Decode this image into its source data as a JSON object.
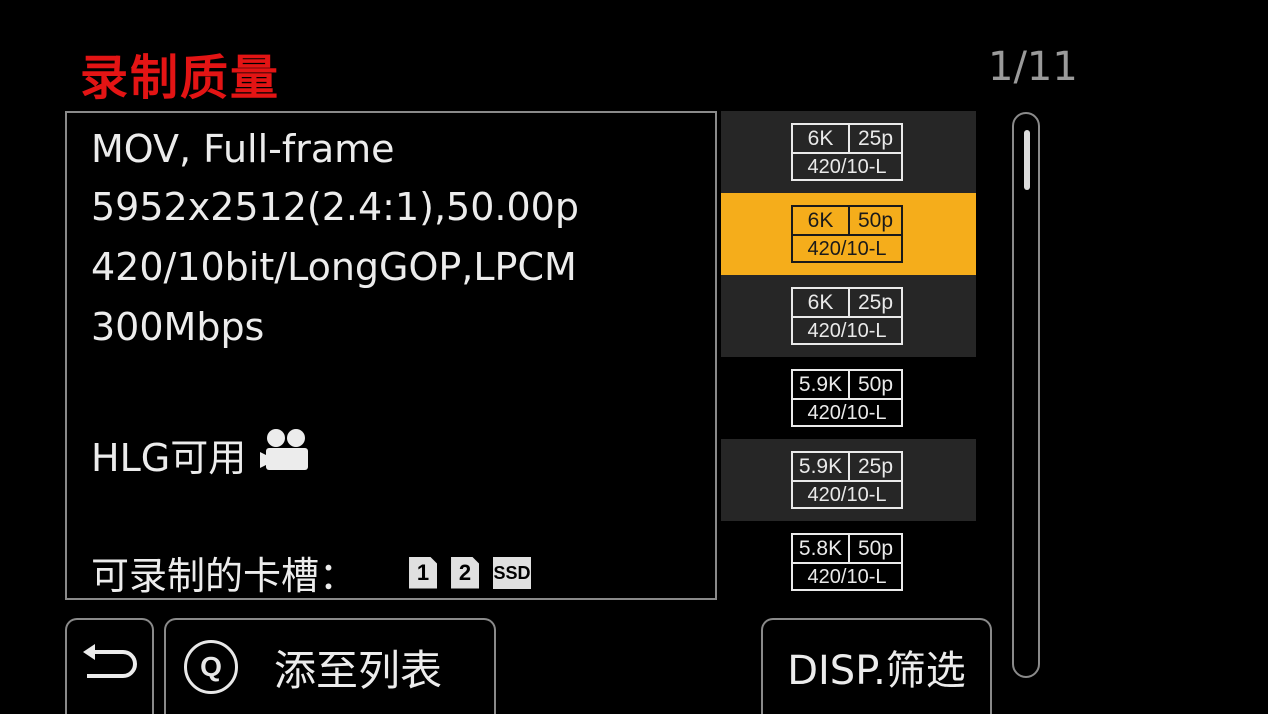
{
  "header": {
    "title": "录制质量",
    "page_indicator": "1/11"
  },
  "info": {
    "lines": [
      "MOV, Full-frame",
      "5952x2512(2.4:1),50.00p",
      "420/10bit/LongGOP,LPCM",
      "300Mbps"
    ],
    "hlg_label": "HLG可用",
    "slots_label": "可录制的卡槽：",
    "slots": [
      "1",
      "2",
      "SSD"
    ]
  },
  "formats": [
    {
      "res": "6K",
      "fps": "25p",
      "codec": "420/10-L"
    },
    {
      "res": "6K",
      "fps": "50p",
      "codec": "420/10-L"
    },
    {
      "res": "6K",
      "fps": "25p",
      "codec": "420/10-L"
    },
    {
      "res": "5.9K",
      "fps": "50p",
      "codec": "420/10-L"
    },
    {
      "res": "5.9K",
      "fps": "25p",
      "codec": "420/10-L"
    },
    {
      "res": "5.8K",
      "fps": "50p",
      "codec": "420/10-L"
    }
  ],
  "selected_index": 1,
  "scroll_position": {
    "page": 1,
    "total_pages": 11
  },
  "footer": {
    "back_icon": "return-arrow-icon",
    "q_label": "Q",
    "add_to_list_label": "添至列表",
    "disp_filter_label": "DISP.筛选"
  },
  "colors": {
    "title": "#e31414",
    "selection": "#f5ad1b",
    "row_alt": "#262626",
    "background": "#000000"
  }
}
